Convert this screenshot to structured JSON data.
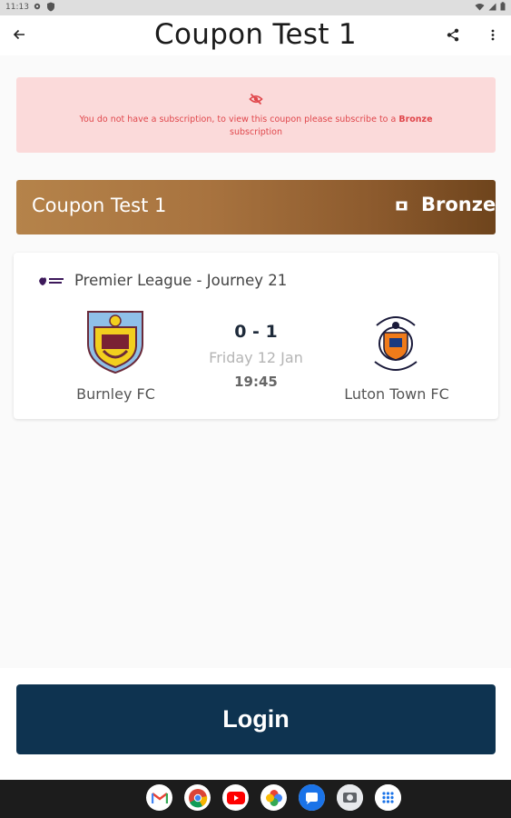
{
  "status_bar": {
    "time": "11:13",
    "icons": [
      "settings-icon",
      "shield-icon",
      "wifi-icon",
      "signal-icon",
      "battery-icon"
    ]
  },
  "app_bar": {
    "title": "Coupon Test 1",
    "back_icon": "arrow-left-icon",
    "share_icon": "share-icon",
    "more_icon": "more-vert-icon"
  },
  "alert": {
    "icon": "eye-off-icon",
    "text_before": "You do not have a subscription, to view this coupon please subscribe to a ",
    "tier": "Bronze",
    "text_after": " subscription",
    "color": "#e0474c",
    "background": "#fbdada"
  },
  "coupon": {
    "name": "Coupon Test 1",
    "tier_icon": "ticket-icon",
    "tier": "Bronze",
    "gradient_start": "#b5834a",
    "gradient_end": "#6e441c"
  },
  "match": {
    "league_logo": "premier-league-logo",
    "league": "Premier League - Journey 21",
    "home_team": "Burnley FC",
    "away_team": "Luton Town FC",
    "score": "0 - 1",
    "date": "Friday 12 Jan",
    "time": "19:45"
  },
  "login": {
    "label": "Login",
    "color": "#0e3350"
  },
  "dock": {
    "apps": [
      "gmail-icon",
      "chrome-icon",
      "youtube-icon",
      "photos-icon",
      "messages-icon",
      "camera-icon",
      "app-drawer-icon"
    ]
  }
}
